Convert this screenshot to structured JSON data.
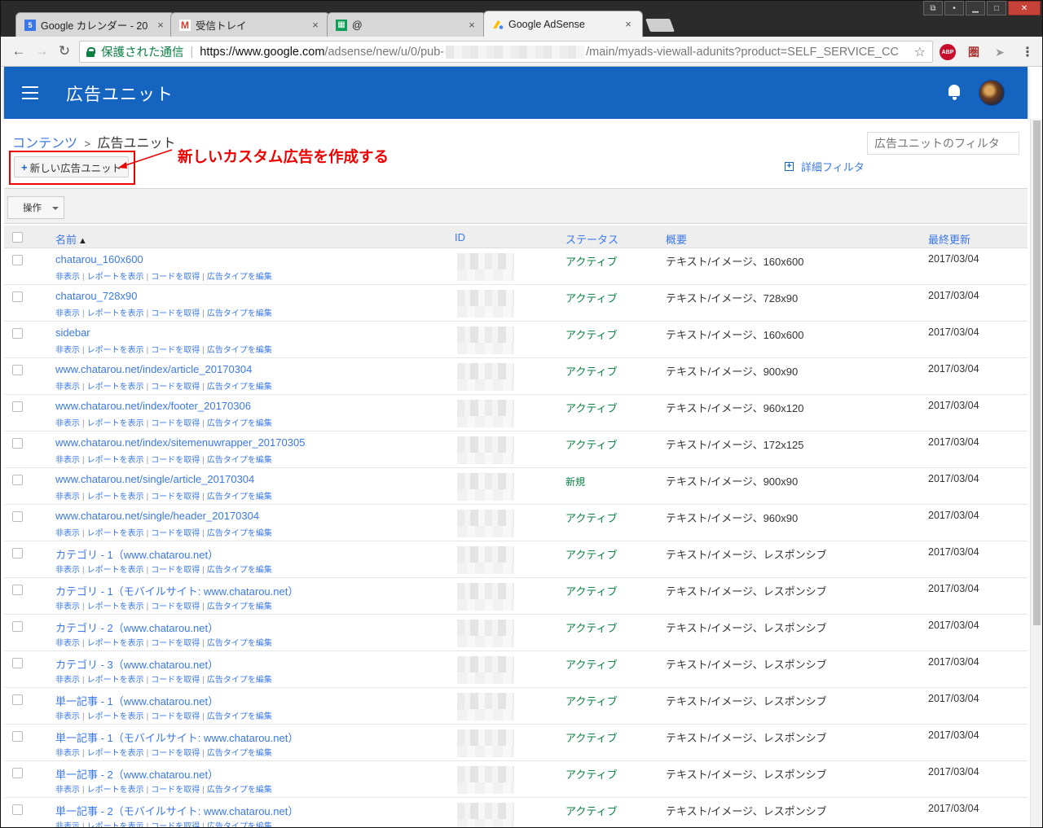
{
  "browser": {
    "tabs": [
      {
        "title": "Google カレンダー - 20",
        "favicon": "calendar-favicon",
        "favicon_text": "5"
      },
      {
        "title": "受信トレイ",
        "favicon": "gmail-favicon",
        "favicon_text": "M"
      },
      {
        "title": "@",
        "favicon": "sheets-favicon",
        "favicon_text": "▦"
      },
      {
        "title": "Google AdSense",
        "favicon": "adsense-favicon",
        "favicon_text": ""
      }
    ],
    "address": {
      "secure_label": "保護された通信",
      "url_host": "https://www.google.com",
      "url_path_start": "/adsense/new/u/0/pub-",
      "url_path_end": "/main/myads-viewall-adunits?product=SELF_SERVICE_CC"
    },
    "extensions": {
      "abp": "ABP"
    }
  },
  "appbar": {
    "title": "広告ユニット"
  },
  "breadcrumb": {
    "parent": "コンテンツ",
    "separator": ">",
    "current": "広告ユニット"
  },
  "toolbar": {
    "new_button": "新しい広告ユニット",
    "filter_placeholder": "広告ユニットのフィルタ",
    "advanced_filter": "詳細フィルタ",
    "action_button": "操作"
  },
  "annotation": {
    "text": "新しいカスタム広告を作成する",
    "color": "#e00000"
  },
  "table": {
    "headers": {
      "name": "名前",
      "id": "ID",
      "status": "ステータス",
      "summary": "概要",
      "updated": "最終更新"
    },
    "row_links": [
      "非表示",
      "レポートを表示",
      "コードを取得",
      "広告タイプを編集"
    ],
    "rows": [
      {
        "name": "chatarou_160x600",
        "status": "アクティブ",
        "summary": "テキスト/イメージ、160x600",
        "updated": "2017/03/04"
      },
      {
        "name": "chatarou_728x90",
        "status": "アクティブ",
        "summary": "テキスト/イメージ、728x90",
        "updated": "2017/03/04"
      },
      {
        "name": "sidebar",
        "status": "アクティブ",
        "summary": "テキスト/イメージ、160x600",
        "updated": "2017/03/04"
      },
      {
        "name": "www.chatarou.net/index/article_20170304",
        "status": "アクティブ",
        "summary": "テキスト/イメージ、900x90",
        "updated": "2017/03/04"
      },
      {
        "name": "www.chatarou.net/index/footer_20170306",
        "status": "アクティブ",
        "summary": "テキスト/イメージ、960x120",
        "updated": "2017/03/04"
      },
      {
        "name": "www.chatarou.net/index/sitemenuwrapper_20170305",
        "status": "アクティブ",
        "summary": "テキスト/イメージ、172x125",
        "updated": "2017/03/04"
      },
      {
        "name": "www.chatarou.net/single/article_20170304",
        "status": "新規",
        "summary": "テキスト/イメージ、900x90",
        "updated": "2017/03/04"
      },
      {
        "name": "www.chatarou.net/single/header_20170304",
        "status": "アクティブ",
        "summary": "テキスト/イメージ、960x90",
        "updated": "2017/03/04"
      },
      {
        "name": "カテゴリ - 1（www.chatarou.net）",
        "status": "アクティブ",
        "summary": "テキスト/イメージ、レスポンシブ",
        "updated": "2017/03/04"
      },
      {
        "name": "カテゴリ - 1（モバイルサイト: www.chatarou.net）",
        "status": "アクティブ",
        "summary": "テキスト/イメージ、レスポンシブ",
        "updated": "2017/03/04"
      },
      {
        "name": "カテゴリ - 2（www.chatarou.net）",
        "status": "アクティブ",
        "summary": "テキスト/イメージ、レスポンシブ",
        "updated": "2017/03/04"
      },
      {
        "name": "カテゴリ - 3（www.chatarou.net）",
        "status": "アクティブ",
        "summary": "テキスト/イメージ、レスポンシブ",
        "updated": "2017/03/04"
      },
      {
        "name": "単一記事 - 1（www.chatarou.net）",
        "status": "アクティブ",
        "summary": "テキスト/イメージ、レスポンシブ",
        "updated": "2017/03/04"
      },
      {
        "name": "単一記事 - 1（モバイルサイト: www.chatarou.net）",
        "status": "アクティブ",
        "summary": "テキスト/イメージ、レスポンシブ",
        "updated": "2017/03/04"
      },
      {
        "name": "単一記事 - 2（www.chatarou.net）",
        "status": "アクティブ",
        "summary": "テキスト/イメージ、レスポンシブ",
        "updated": "2017/03/04"
      },
      {
        "name": "単一記事 - 2（モバイルサイト: www.chatarou.net）",
        "status": "アクティブ",
        "summary": "テキスト/イメージ、レスポンシブ",
        "updated": "2017/03/04"
      }
    ]
  },
  "colors": {
    "appbar": "#1565c0",
    "link": "#3b78e7",
    "status_active": "#0b8043",
    "annotation": "#e00000"
  }
}
